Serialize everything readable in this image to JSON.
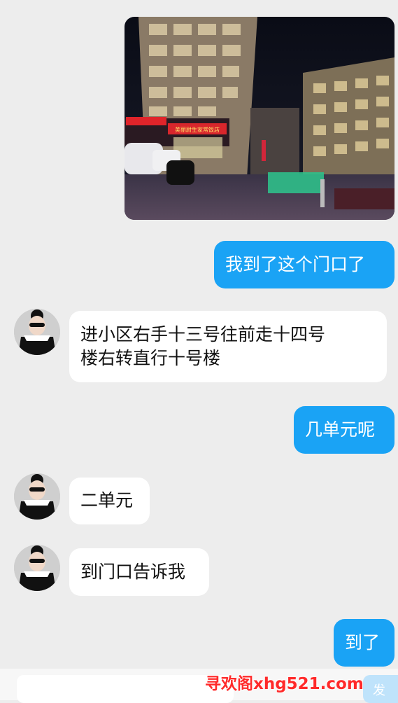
{
  "messages": [
    {
      "sender": "me",
      "type": "image"
    },
    {
      "sender": "me",
      "type": "text",
      "text": "我到了这个门口了"
    },
    {
      "sender": "them",
      "type": "text",
      "line1": "进小区右手十三号往前走十四号",
      "line2": "楼右转直行十号楼"
    },
    {
      "sender": "me",
      "type": "text",
      "text": "几单元呢"
    },
    {
      "sender": "them",
      "type": "text",
      "text": "二单元"
    },
    {
      "sender": "them",
      "type": "text",
      "text": "到门口告诉我"
    },
    {
      "sender": "me",
      "type": "text",
      "text": "到了"
    }
  ],
  "photo": {
    "shop_sign": "美丽尉生家常饭店"
  },
  "composer": {
    "send_label": "发"
  },
  "watermark": "寻欢阁xhg521.com",
  "colors": {
    "background": "#ededed",
    "my_bubble": "#1aa3f5",
    "their_bubble": "#ffffff"
  }
}
